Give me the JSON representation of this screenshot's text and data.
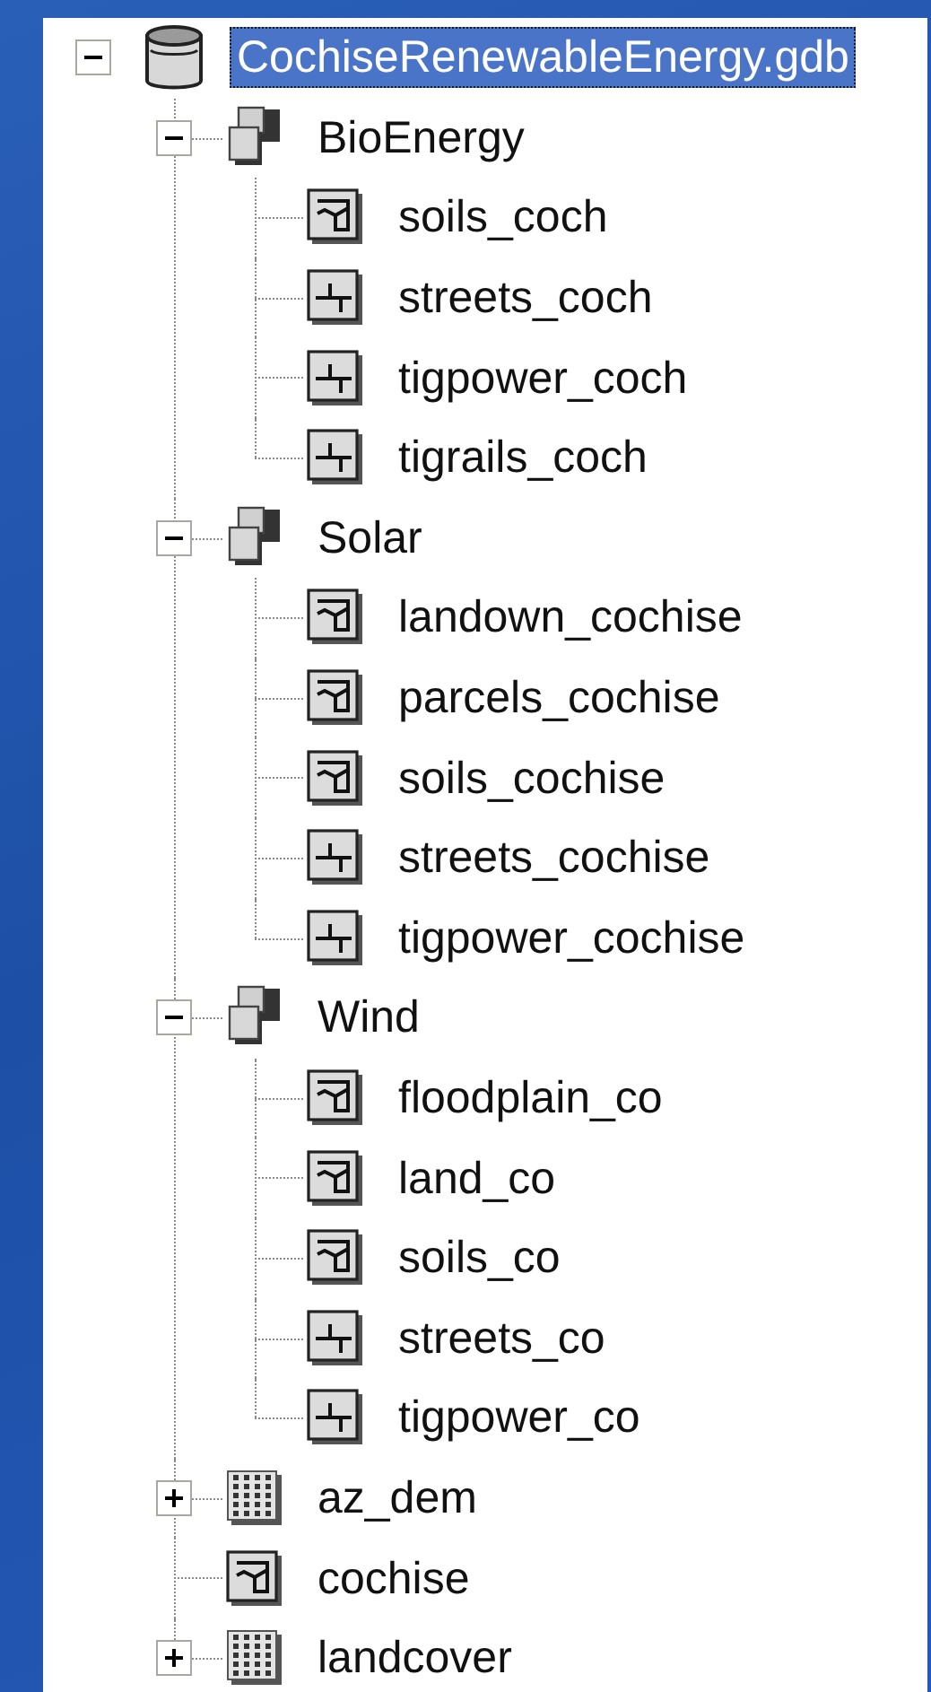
{
  "tree": [
    {
      "kind": "database",
      "label": "CochiseRenewableEnergy.gdb",
      "selected": true,
      "expanded": true,
      "children": [
        {
          "kind": "feature_dataset",
          "label": "BioEnergy",
          "selected": false,
          "expanded": true,
          "children": [
            {
              "kind": "polygon_class",
              "label": "soils_coch",
              "selected": false
            },
            {
              "kind": "line_class",
              "label": "streets_coch",
              "selected": false
            },
            {
              "kind": "line_class",
              "label": "tigpower_coch",
              "selected": false
            },
            {
              "kind": "line_class",
              "label": "tigrails_coch",
              "selected": false
            }
          ]
        },
        {
          "kind": "feature_dataset",
          "label": "Solar",
          "selected": false,
          "expanded": true,
          "children": [
            {
              "kind": "polygon_class",
              "label": "landown_cochise",
              "selected": false
            },
            {
              "kind": "polygon_class",
              "label": "parcels_cochise",
              "selected": false
            },
            {
              "kind": "polygon_class",
              "label": "soils_cochise",
              "selected": false
            },
            {
              "kind": "line_class",
              "label": "streets_cochise",
              "selected": false
            },
            {
              "kind": "line_class",
              "label": "tigpower_cochise",
              "selected": false
            }
          ]
        },
        {
          "kind": "feature_dataset",
          "label": "Wind",
          "selected": false,
          "expanded": true,
          "children": [
            {
              "kind": "polygon_class",
              "label": "floodplain_co",
              "selected": false
            },
            {
              "kind": "polygon_class",
              "label": "land_co",
              "selected": false
            },
            {
              "kind": "polygon_class",
              "label": "soils_co",
              "selected": false
            },
            {
              "kind": "line_class",
              "label": "streets_co",
              "selected": false
            },
            {
              "kind": "line_class",
              "label": "tigpower_co",
              "selected": false
            }
          ]
        },
        {
          "kind": "raster",
          "label": "az_dem",
          "selected": false,
          "expanded": false
        },
        {
          "kind": "polygon_class",
          "label": "cochise",
          "selected": false
        },
        {
          "kind": "raster",
          "label": "landcover",
          "selected": false,
          "expanded": false
        }
      ]
    }
  ]
}
